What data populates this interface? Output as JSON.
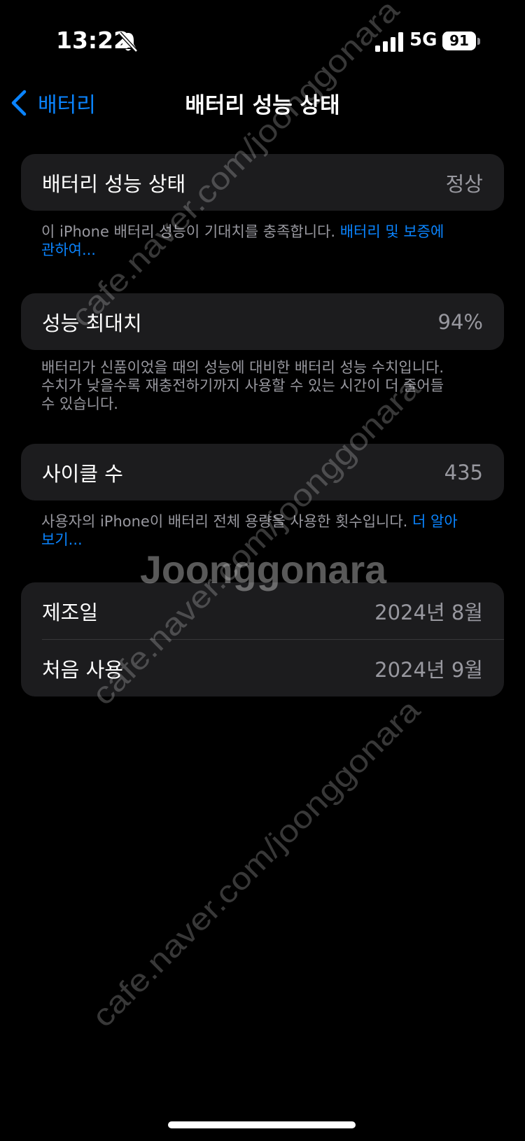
{
  "status_bar": {
    "time": "13:22",
    "network": "5G",
    "battery_level": "91"
  },
  "nav": {
    "back_label": "배터리",
    "title": "배터리 성능 상태"
  },
  "sections": {
    "health": {
      "label": "배터리 성능 상태",
      "value": "정상",
      "footnote": "이 iPhone 배터리 성능이 기대치를 충족합니다. ",
      "link": "배터리 및 보증에 관하여..."
    },
    "max_capacity": {
      "label": "성능 최대치",
      "value": "94%",
      "footnote": "배터리가 신품이었을 때의 성능에 대비한 배터리 성능 수치입니다. 수치가 낮을수록 재충전하기까지 사용할 수 있는 시간이 더 줄어들 수 있습니다."
    },
    "cycle_count": {
      "label": "사이클 수",
      "value": "435",
      "footnote": "사용자의 iPhone이 배터리 전체 용량을 사용한 횟수입니다. ",
      "link": "더 알아보기..."
    },
    "dates": {
      "manufacture_label": "제조일",
      "manufacture_value": "2024년 8월",
      "first_use_label": "처음 사용",
      "first_use_value": "2024년 9월"
    }
  },
  "watermark": {
    "url": "cafe.naver.com/joonggonara",
    "brand": "Joonggonara"
  },
  "colors": {
    "background": "#000000",
    "card": "#1c1c1e",
    "accent": "#0a84ff",
    "secondary_text": "#98989f"
  }
}
